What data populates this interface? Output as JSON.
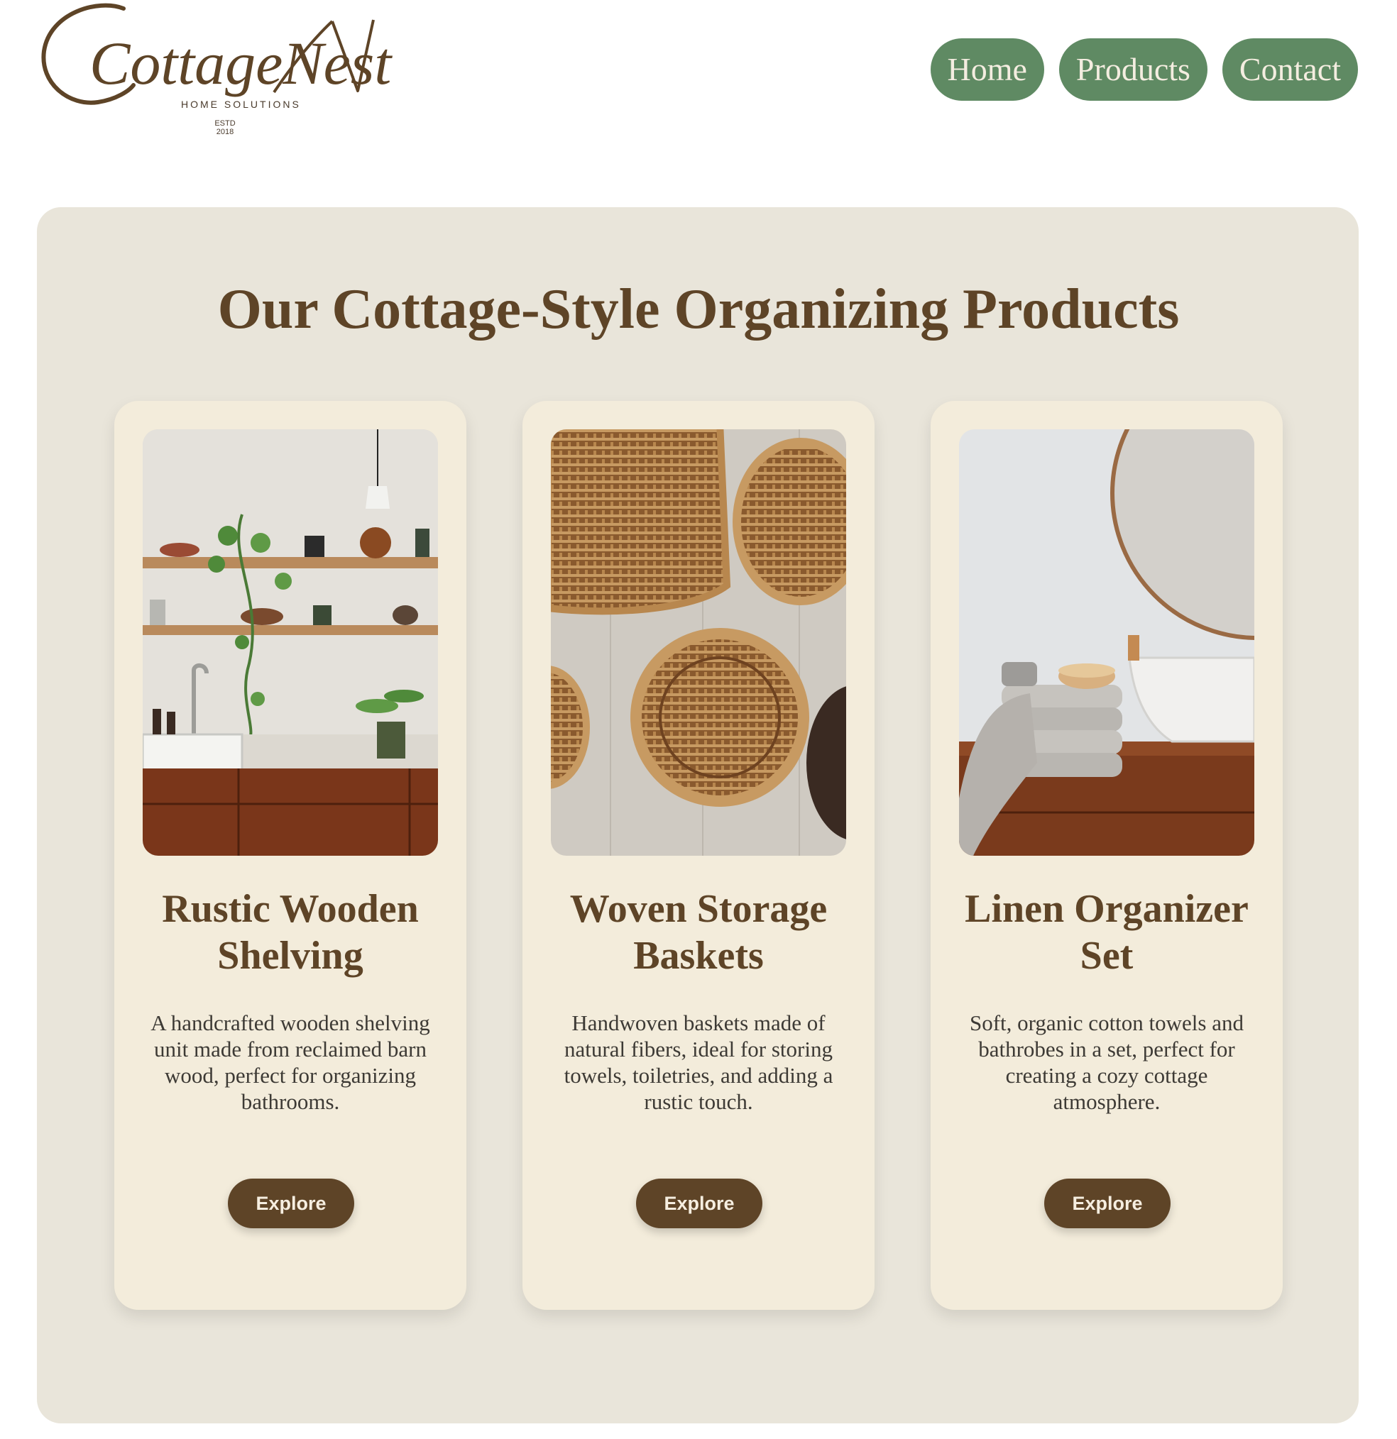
{
  "brand": {
    "logo_text": "CottageNest",
    "tagline": "HOME SOLUTIONS",
    "estd": "ESTD",
    "year": "2018"
  },
  "nav": {
    "items": [
      {
        "label": "Home"
      },
      {
        "label": "Products"
      },
      {
        "label": "Contact"
      }
    ]
  },
  "main": {
    "title": "Our Cottage-Style Organizing Products",
    "products": [
      {
        "title": "Rustic Wooden Shelving",
        "description": "A handcrafted wooden shelving unit made from reclaimed barn wood, perfect for organizing bathrooms.",
        "button": "Explore"
      },
      {
        "title": "Woven Storage Baskets",
        "description": "Handwoven baskets made of natural fibers, ideal for storing towels, toiletries, and adding a rustic touch.",
        "button": "Explore"
      },
      {
        "title": "Linen Organizer Set",
        "description": "Soft, organic cotton towels and bathrobes in a set, perfect for creating a cozy cottage atmosphere.",
        "button": "Explore"
      }
    ]
  },
  "colors": {
    "nav_green": "#5f8a63",
    "brown": "#5e4427",
    "panel": "#e9e5da",
    "card": "#f3ecdb"
  }
}
